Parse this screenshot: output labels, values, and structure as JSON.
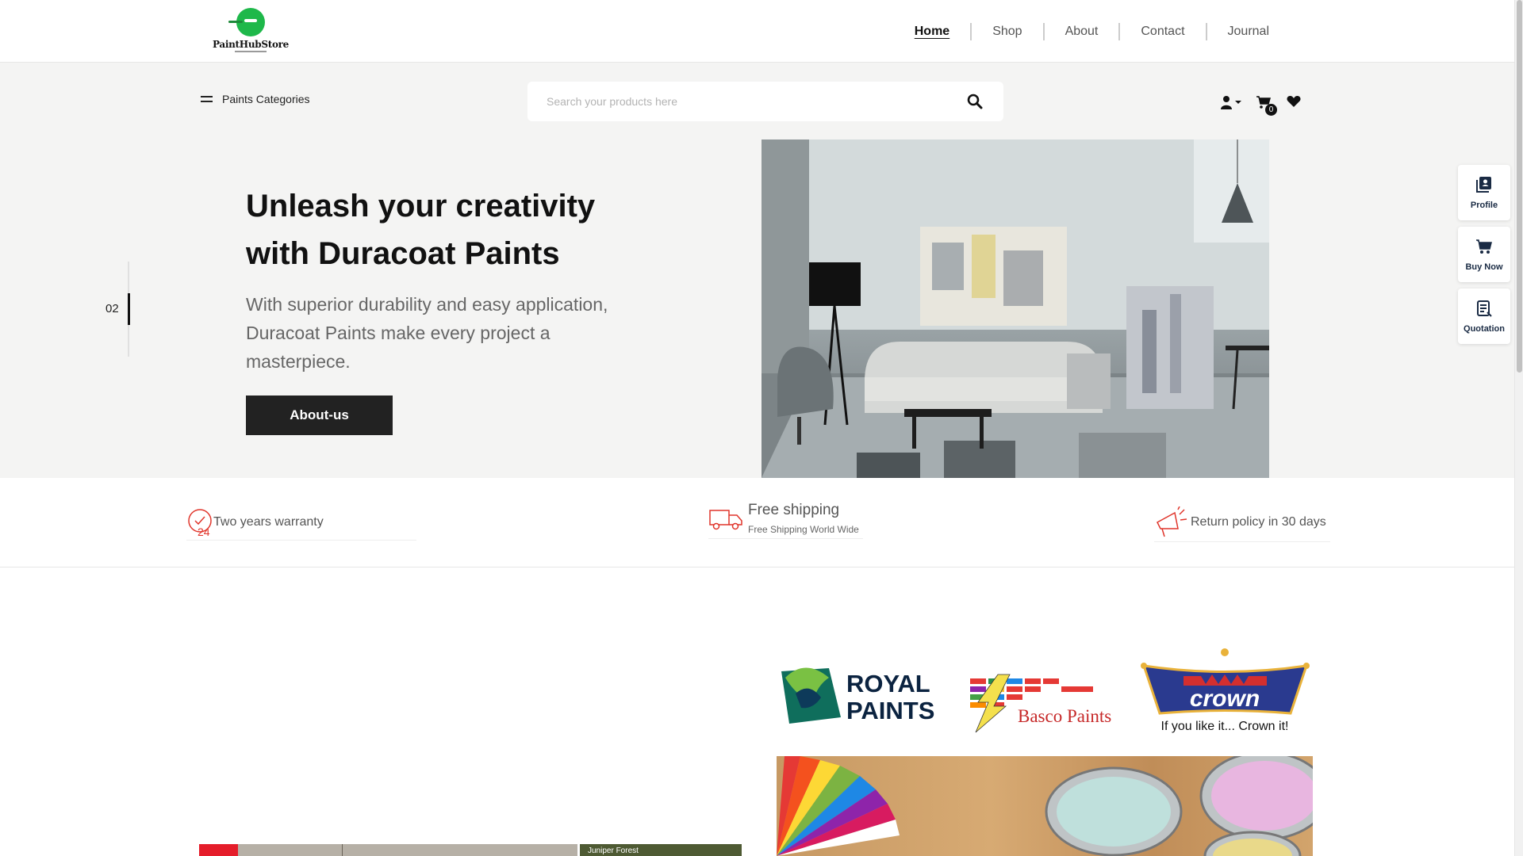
{
  "header": {
    "logo_text": "PaintHubStore",
    "nav": [
      {
        "label": "Home",
        "active": true
      },
      {
        "label": "Shop",
        "active": false
      },
      {
        "label": "About",
        "active": false
      },
      {
        "label": "Contact",
        "active": false
      },
      {
        "label": "Journal",
        "active": false
      }
    ]
  },
  "toolbar": {
    "categories_label": "Paints Categories",
    "search_placeholder": "Search your products here",
    "cart_count": "0"
  },
  "hero": {
    "slide_number": "02",
    "title": "Unleash your creativity with Duracoat Paints",
    "subtitle": "With superior durability and easy application, Duracoat Paints make every project a masterpiece.",
    "button_label": "About-us"
  },
  "side_widget": {
    "items": [
      {
        "label": "Profile",
        "icon": "profile-book-icon"
      },
      {
        "label": "Buy Now",
        "icon": "cart-icon"
      },
      {
        "label": "Quotation",
        "icon": "quotation-icon"
      }
    ]
  },
  "features": [
    {
      "title": "Two years warranty",
      "icon": "warranty-24-icon"
    },
    {
      "title": "Free shipping",
      "subtitle": "Free Shipping World Wide",
      "icon": "truck-icon"
    },
    {
      "title": "Return policy in 30 days",
      "icon": "megaphone-icon"
    }
  ],
  "brands": {
    "royal": [
      "ROYAL",
      "PAINTS"
    ],
    "basco": "Basco Paints",
    "crown": "crown",
    "crown_tagline": "If you like it... Crown it!"
  },
  "promo": {
    "right_label": "Juniper Forest"
  },
  "colors": {
    "accent_red": "#e0352b",
    "dark_button": "#222222",
    "hero_background": "#f4f4f3",
    "logo_green": "#1eb84a"
  }
}
